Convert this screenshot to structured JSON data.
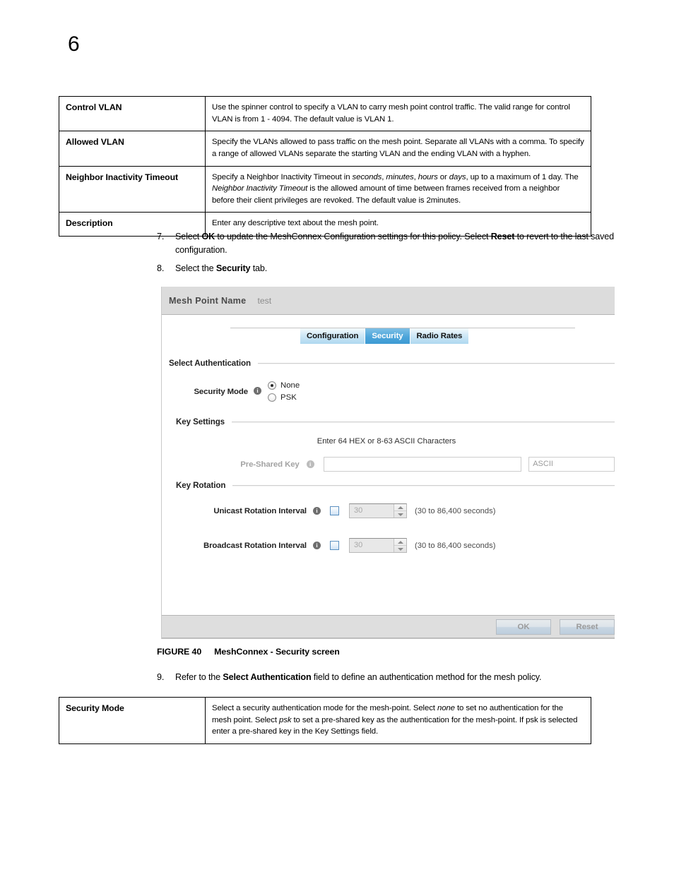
{
  "page": {
    "number": "6"
  },
  "top_table": {
    "rows": [
      {
        "term": "Control VLAN",
        "desc": "Use the spinner control to specify a VLAN to carry mesh point control traffic. The valid range for control VLAN is from 1 - 4094. The default value is VLAN 1."
      },
      {
        "term": "Allowed VLAN",
        "desc": "Specify the VLANs allowed to pass traffic on the mesh point. Separate all VLANs with a comma. To specify a range of allowed VLANs separate the starting VLAN and the ending VLAN with a hyphen."
      },
      {
        "term": "Neighbor Inactivity Timeout",
        "desc_parts": [
          {
            "t": "Specify a Neighbor Inactivity Timeout in ",
            "i": false
          },
          {
            "t": "seconds",
            "i": true
          },
          {
            "t": ", ",
            "i": false
          },
          {
            "t": "minutes",
            "i": true
          },
          {
            "t": ", ",
            "i": false
          },
          {
            "t": "hours",
            "i": true
          },
          {
            "t": " or ",
            "i": false
          },
          {
            "t": "days",
            "i": true
          },
          {
            "t": ", up to a maximum of 1 day. The ",
            "i": false
          },
          {
            "t": "Neighbor Inactivity Timeout",
            "i": true
          },
          {
            "t": " is the allowed amount of time between frames received from a neighbor before their client privileges are revoked. The default value is 2minutes.",
            "i": false
          }
        ]
      },
      {
        "term": "Description",
        "desc": "Enter any descriptive text about the mesh point."
      }
    ]
  },
  "steps": {
    "step7": {
      "num": "7.",
      "parts": [
        {
          "t": "Select ",
          "b": false
        },
        {
          "t": "OK",
          "b": true
        },
        {
          "t": " to update the MeshConnex Configuration settings for this policy. Select ",
          "b": false
        },
        {
          "t": "Reset",
          "b": true
        },
        {
          "t": " to revert to the last saved configuration.",
          "b": false
        }
      ]
    },
    "step8": {
      "num": "8.",
      "parts": [
        {
          "t": "Select the ",
          "b": false
        },
        {
          "t": "Security",
          "b": true
        },
        {
          "t": " tab.",
          "b": false
        }
      ]
    },
    "step9": {
      "num": "9.",
      "parts": [
        {
          "t": "Refer to the ",
          "b": false
        },
        {
          "t": "Select Authentication",
          "b": true
        },
        {
          "t": " field to define an authentication method for the mesh policy.",
          "b": false
        }
      ]
    }
  },
  "figure": {
    "label": "FIGURE 40",
    "caption": "MeshConnex - Security screen"
  },
  "app": {
    "header": {
      "label": "Mesh Point Name",
      "value": "test"
    },
    "tabs": [
      {
        "label": "Configuration",
        "active": false
      },
      {
        "label": "Security",
        "active": true
      },
      {
        "label": "Radio Rates",
        "active": false
      }
    ],
    "sections": {
      "select_authentication": {
        "title": "Select Authentication",
        "security_mode": {
          "label": "Security Mode",
          "info_icon": "info-icon",
          "options": [
            {
              "label": "None",
              "checked": true
            },
            {
              "label": "PSK",
              "checked": false
            }
          ]
        }
      },
      "key_settings": {
        "title": "Key Settings",
        "note": "Enter 64 HEX or 8-63 ASCII Characters",
        "pre_shared_key": {
          "label": "Pre-Shared Key",
          "info_icon": "info-icon",
          "value": "",
          "format_value": "ASCII"
        }
      },
      "key_rotation": {
        "title": "Key Rotation",
        "unicast": {
          "label": "Unicast Rotation Interval",
          "info_icon": "info-icon",
          "checked": false,
          "value": "30",
          "hint": "(30 to 86,400 seconds)"
        },
        "broadcast": {
          "label": "Broadcast Rotation Interval",
          "info_icon": "info-icon",
          "checked": false,
          "value": "30",
          "hint": "(30 to 86,400 seconds)"
        }
      }
    },
    "footer": {
      "ok_label": "OK",
      "reset_label": "Reset"
    }
  },
  "bottom_table": {
    "rows": [
      {
        "term": "Security Mode",
        "desc_parts": [
          {
            "t": "Select a security authentication mode for the mesh-point. Select ",
            "i": false
          },
          {
            "t": "none",
            "i": true
          },
          {
            "t": " to set no authentication for the mesh point. Select ",
            "i": false
          },
          {
            "t": "psk",
            "i": true
          },
          {
            "t": " to set a pre-shared key as the authentication for the mesh-point. If psk is selected enter a pre-shared key in the Key Settings field.",
            "i": false
          }
        ]
      }
    ]
  },
  "colors": {
    "tab_active": "#3d9ad3",
    "panel_header_bg": "#dcdcdc",
    "checkbox_border": "#5a8fc0"
  }
}
